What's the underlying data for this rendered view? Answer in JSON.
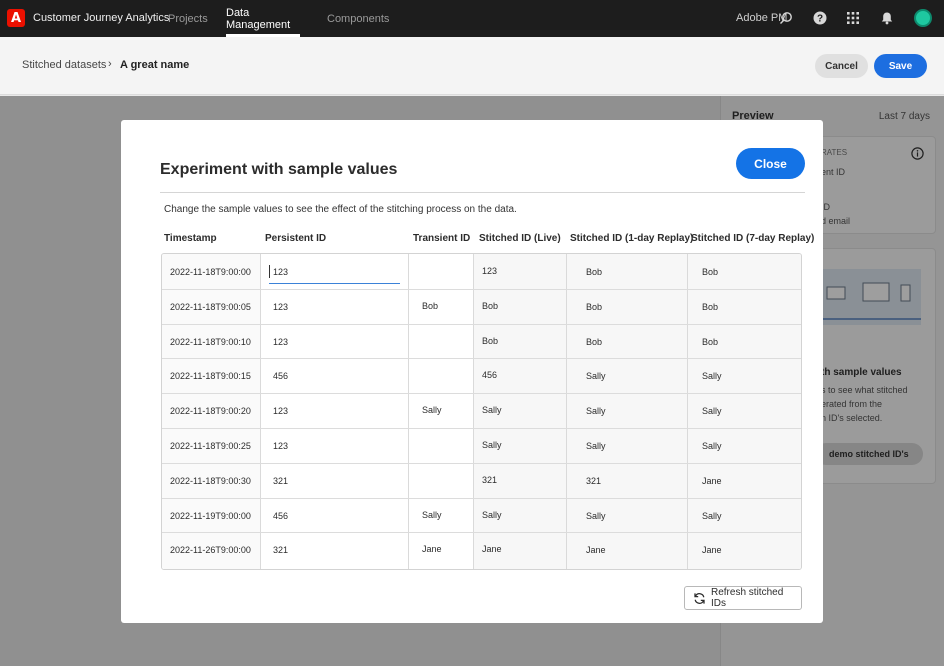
{
  "topbar": {
    "app_name": "Customer Journey Analytics",
    "nav": [
      "Projects",
      "Data Management",
      "Components"
    ],
    "org": "Adobe PM"
  },
  "header": {
    "breadcrumb_parent": "Stitched datasets",
    "breadcrumb_current": "A great name",
    "cancel_label": "Cancel",
    "save_label": "Save"
  },
  "preview": {
    "title": "Preview",
    "range": "Last 7 days",
    "card1": {
      "label": "RATES",
      "line1": "ent ID",
      "line2": "ID",
      "line3": "d email"
    },
    "card2": {
      "heading": "th sample values",
      "line1": "s to see what stitched",
      "line2": "erated from the",
      "line3": "n ID's selected.",
      "button": "demo stitched ID's"
    }
  },
  "dialog": {
    "title": "Experiment with sample values",
    "close_label": "Close",
    "description": "Change the sample values to see the effect of the stitching process on the data.",
    "columns": [
      "Timestamp",
      "Persistent ID",
      "Transient ID",
      "Stitched ID (Live)",
      "Stitched ID (1-day Replay)",
      "Stitched ID (7-day Replay)"
    ],
    "rows": [
      [
        "2022-11-18T9:00:00",
        "123",
        "",
        "123",
        "Bob",
        "Bob"
      ],
      [
        "2022-11-18T9:00:05",
        "123",
        "Bob",
        "Bob",
        "Bob",
        "Bob"
      ],
      [
        "2022-11-18T9:00:10",
        "123",
        "",
        "Bob",
        "Bob",
        "Bob"
      ],
      [
        "2022-11-18T9:00:15",
        "456",
        "",
        "456",
        "Sally",
        "Sally"
      ],
      [
        "2022-11-18T9:00:20",
        "123",
        "Sally",
        "Sally",
        "Sally",
        "Sally"
      ],
      [
        "2022-11-18T9:00:25",
        "123",
        "",
        "Sally",
        "Sally",
        "Sally"
      ],
      [
        "2022-11-18T9:00:30",
        "321",
        "",
        "321",
        "321",
        "Jane"
      ],
      [
        "2022-11-19T9:00:00",
        "456",
        "Sally",
        "Sally",
        "Sally",
        "Sally"
      ],
      [
        "2022-11-26T9:00:00",
        "321",
        "Jane",
        "Jane",
        "Jane",
        "Jane"
      ]
    ],
    "refresh_label": "Refresh stitched IDs"
  },
  "colors": {
    "accent": "#1473e6",
    "topbar": "#1d1d1d",
    "avatar": "#1ec8a0",
    "logo": "#eb1000"
  }
}
